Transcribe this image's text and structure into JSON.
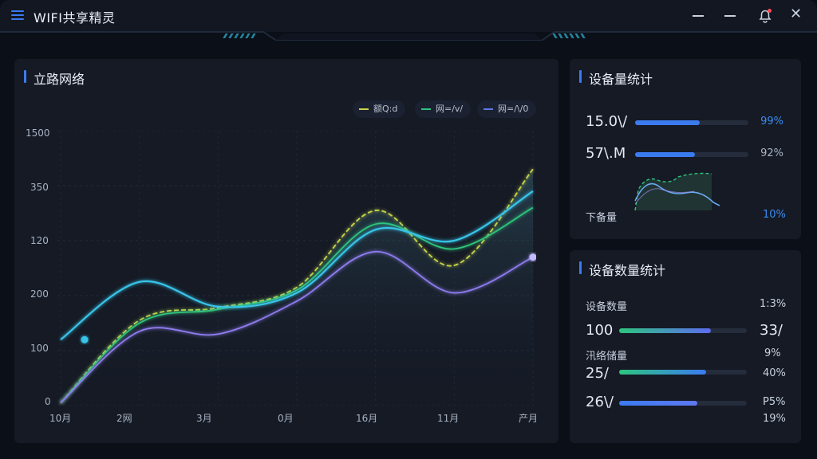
{
  "app": {
    "title": "WIFI共享精灵"
  },
  "window_controls": [
    "minimize",
    "maximize",
    "notifications",
    "close"
  ],
  "main_panel": {
    "title": "立路网络",
    "legend": [
      {
        "label": "额Q:d",
        "color": "#c8d64a"
      },
      {
        "label": "网=/v/",
        "color": "#2dc57e"
      },
      {
        "label": "网=/\\/0",
        "color": "#5e78f0"
      }
    ]
  },
  "chart_data": {
    "type": "line",
    "title": "立路网络",
    "y_ticks": [
      "0",
      "100",
      "200",
      "120",
      "350",
      "1500"
    ],
    "categories": [
      "10月",
      "2网",
      "3月",
      "0月",
      "16月",
      "11月",
      "产月"
    ],
    "grid": true,
    "legend_position": "top-right",
    "series": [
      {
        "name": "额Q:d",
        "color": "#c8d64a",
        "values": [
          5,
          155,
          178,
          215,
          355,
          255,
          430
        ]
      },
      {
        "name": "网=/v/",
        "color": "#2dc57e",
        "values": [
          5,
          150,
          175,
          210,
          330,
          285,
          360
        ]
      },
      {
        "name": "网=/\\/0",
        "color": "#8f7cf0",
        "values": [
          5,
          135,
          130,
          190,
          280,
          205,
          270
        ]
      },
      {
        "name": "",
        "color": "#37c4e8",
        "values": [
          120,
          225,
          180,
          205,
          320,
          300,
          390
        ]
      }
    ]
  },
  "device_panel": {
    "title": "设备量统计",
    "rows": [
      {
        "value": "15.0\\/",
        "percent": "99%",
        "fill": 0.57,
        "color": "#3b7bf0",
        "pct_color": "#3b8cf0"
      },
      {
        "value": "57\\.M",
        "percent": "92%",
        "fill": 0.53,
        "color": "#3b7bf0",
        "pct_color": "#a9b3c2"
      }
    ],
    "mini_label": "下备量",
    "mini_percent": "10%"
  },
  "count_panel": {
    "title": "设备数量统计",
    "rows": [
      {
        "label": "设备数量",
        "label_pct": "1:3%",
        "value": "100",
        "value_pct": "33/",
        "fill": 0.72,
        "grad_from": "#2dc57e",
        "grad_to": "#5e6bf0"
      },
      {
        "label": "汛络储量",
        "label_pct": "9%",
        "value": "25/",
        "value_pct": "40%",
        "fill": 0.68,
        "grad_from": "#2dc57e",
        "grad_to": "#3b7bf0"
      },
      {
        "label": "",
        "label_pct": "P5%",
        "value": "26\\/",
        "value_pct": "19%",
        "fill": 0.61,
        "grad_from": "#3b7bf0",
        "grad_to": "#5e78f0"
      }
    ]
  }
}
